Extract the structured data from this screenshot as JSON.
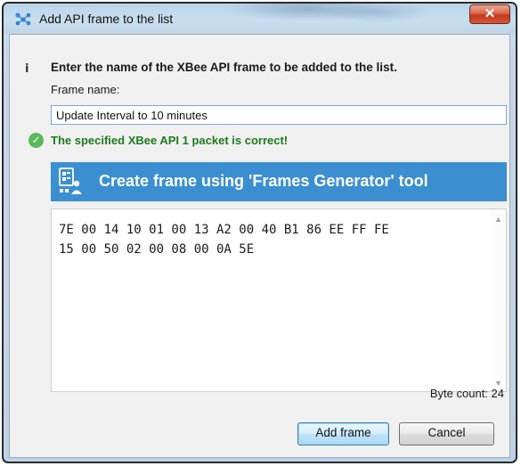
{
  "window": {
    "title": "Add API frame to the list",
    "close_label": "✕"
  },
  "dialog": {
    "instruction": "Enter the name of the XBee API frame to be added to the list.",
    "frame_name_label": "Frame name:",
    "frame_name_value": "Update Interval to 10 minutes",
    "status_message": "The specified XBee API 1 packet is correct!",
    "generator_button_label": "Create frame using 'Frames Generator' tool",
    "hex_content": "7E 00 14 10 01 00 13 A2 00 40 B1 86 EE FF FE\n15 00 50 02 00 08 00 0A 5E",
    "byte_count_label": "Byte count: 24"
  },
  "buttons": {
    "add_frame": "Add frame",
    "cancel": "Cancel"
  },
  "icons": {
    "app": "network-nodes-icon",
    "info": "info-icon",
    "status": "check-circle-icon",
    "generator": "frames-generator-icon"
  },
  "colors": {
    "accent": "#3b8fd0",
    "success": "#1e7a1e",
    "close": "#c3391c"
  }
}
